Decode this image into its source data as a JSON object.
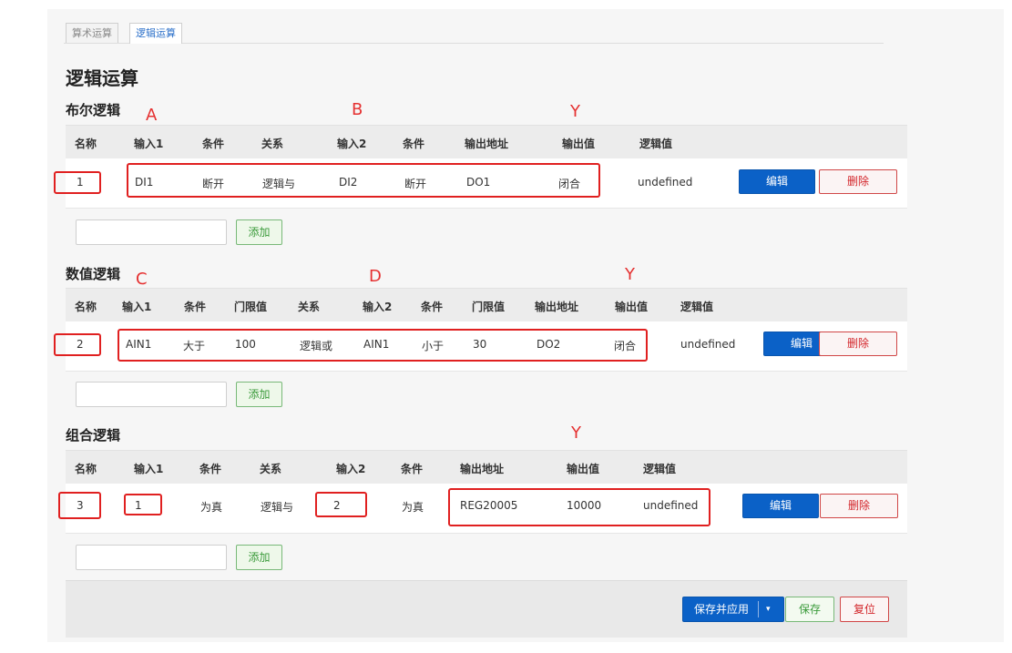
{
  "tabs": [
    "算术运算",
    "逻辑运算"
  ],
  "page_title": "逻辑运算",
  "boolean": {
    "title": "布尔逻辑",
    "annotations": [
      "A",
      "B",
      "Y"
    ],
    "headers": [
      "名称",
      "输入1",
      "条件",
      "关系",
      "输入2",
      "条件",
      "输出地址",
      "输出值",
      "逻辑值"
    ],
    "row": [
      "1",
      "DI1",
      "断开",
      "逻辑与",
      "DI2",
      "断开",
      "DO1",
      "闭合",
      "undefined"
    ],
    "edit_label": "编辑",
    "delete_label": "删除",
    "add_label": "添加"
  },
  "numeric": {
    "title": "数值逻辑",
    "annotations": [
      "C",
      "D",
      "Y"
    ],
    "headers": [
      "名称",
      "输入1",
      "条件",
      "门限值",
      "关系",
      "输入2",
      "条件",
      "门限值",
      "输出地址",
      "输出值",
      "逻辑值"
    ],
    "row": [
      "2",
      "AIN1",
      "大于",
      "100",
      "逻辑或",
      "AIN1",
      "小于",
      "30",
      "DO2",
      "闭合",
      "undefined"
    ],
    "edit_label": "编辑",
    "delete_label": "删除",
    "add_label": "添加"
  },
  "combined": {
    "title": "组合逻辑",
    "annotations": [
      "Y"
    ],
    "headers": [
      "名称",
      "输入1",
      "条件",
      "关系",
      "输入2",
      "条件",
      "输出地址",
      "输出值",
      "逻辑值"
    ],
    "row": [
      "3",
      "1",
      "为真",
      "逻辑与",
      "2",
      "为真",
      "REG20005",
      "10000",
      "undefined"
    ],
    "edit_label": "编辑",
    "delete_label": "删除",
    "add_label": "添加"
  },
  "footer": {
    "save_apply_label": "保存并应用",
    "caret": "▾",
    "save_label": "保存",
    "reset_label": "复位"
  },
  "colors": {
    "primary": "#0b61c7",
    "danger": "#d3262b",
    "success": "#3a9a3a",
    "annotation": "#e02020"
  }
}
